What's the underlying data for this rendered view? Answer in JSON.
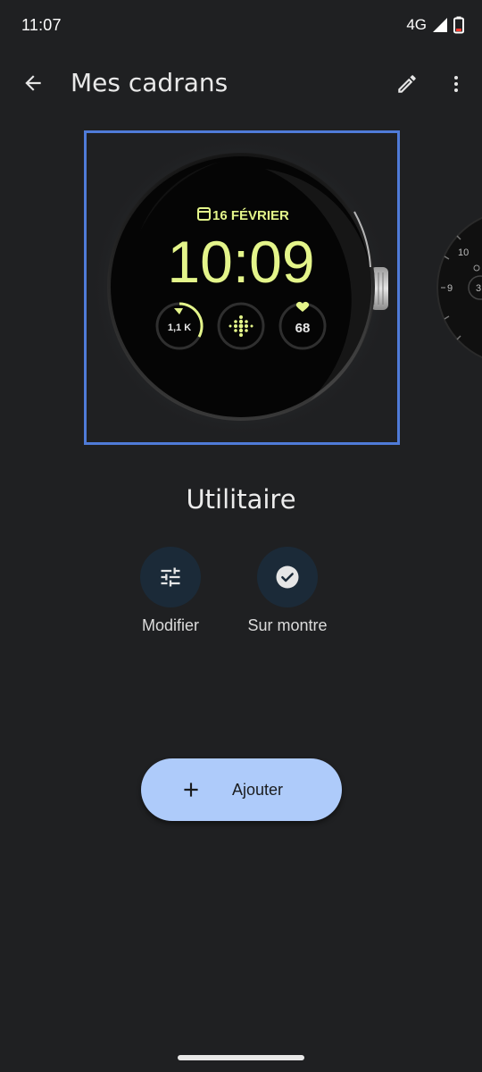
{
  "status_bar": {
    "time": "11:07",
    "network": "4G"
  },
  "app_bar": {
    "title": "Mes cadrans",
    "icons": [
      "back-arrow-icon",
      "pencil-icon",
      "more-vert-icon"
    ]
  },
  "watch_preview": {
    "date": "16 FÉVRIER",
    "time": "10:09",
    "complications": {
      "steps": "1,1 K",
      "heart_rate": "68"
    },
    "peek_face": {
      "numbers": [
        "10",
        "9",
        "3"
      ]
    }
  },
  "face": {
    "name": "Utilitaire"
  },
  "actions": {
    "modify_label": "Modifier",
    "on_watch_label": "Sur montre"
  },
  "add_button": {
    "label": "Ajouter"
  },
  "colors": {
    "background": "#1f2022",
    "selection_border": "#4f7bd8",
    "accent_button": "#aecbfa",
    "watch_text": "#e4f58a",
    "action_circle": "#1b2a38"
  }
}
